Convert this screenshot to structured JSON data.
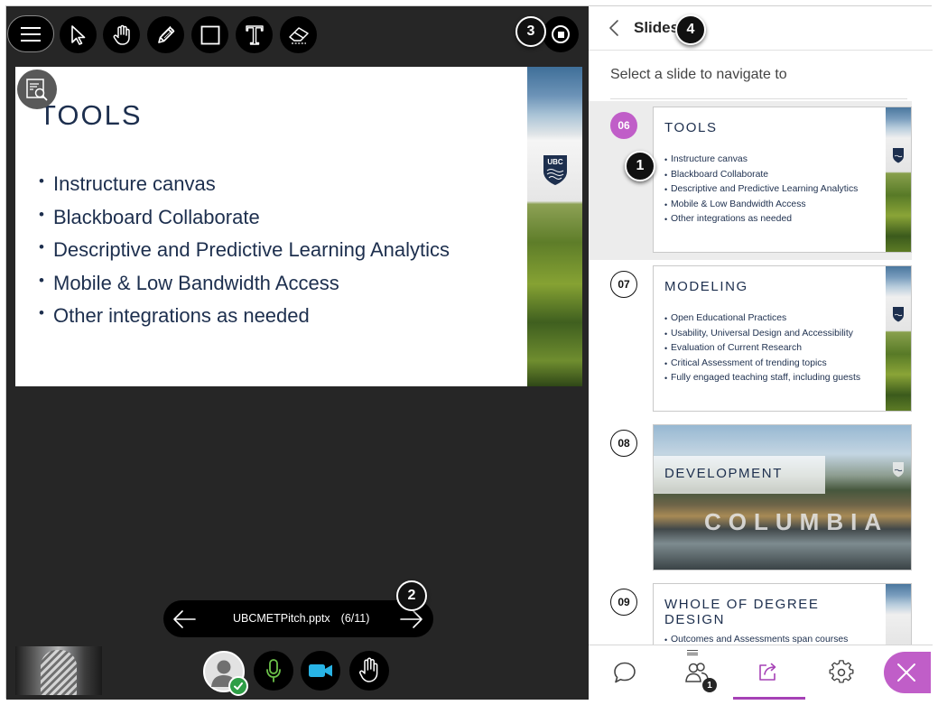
{
  "stage": {
    "current_slide": {
      "title": "TOOLS",
      "bullets": [
        "Instructure canvas",
        "Blackboard Collaborate",
        "Descriptive and Predictive Learning Analytics",
        "Mobile & Low Bandwidth Access",
        "Other integrations as needed"
      ]
    },
    "navigation": {
      "file_name": "UBCMETPitch.pptx",
      "position": "(6/11)"
    },
    "crest_text": "UBC"
  },
  "callouts": [
    "1",
    "2",
    "3",
    "4"
  ],
  "panel": {
    "title": "Slides",
    "subtitle": "Select a slide to navigate to",
    "slides": [
      {
        "number": "06",
        "title": "TOOLS",
        "bullets": [
          "Instructure canvas",
          "Blackboard Collaborate",
          "Descriptive and Predictive Learning Analytics",
          "Mobile & Low Bandwidth Access",
          "Other integrations as needed"
        ]
      },
      {
        "number": "07",
        "title": "MODELING",
        "bullets": [
          "Open Educational Practices",
          "Usability, Universal Design and Accessibility",
          "Evaluation of Current Research",
          "Critical Assessment of trending topics",
          "Fully engaged teaching staff, including guests"
        ]
      },
      {
        "number": "08",
        "title": "DEVELOPMENT",
        "photo_text": "COLUMBIA"
      },
      {
        "number": "09",
        "title": "WHOLE OF DEGREE DESIGN",
        "bullets": [
          "Outcomes and Assessments span courses"
        ]
      }
    ],
    "attendee_count": "1"
  },
  "colors": {
    "accent": "#c05ec8",
    "active_tab": "#a642b6",
    "stage_bg": "#262626",
    "slide_text": "#1d2f4e",
    "status_ok": "#2e9e46",
    "mic": "#6cc24a",
    "camera": "#28b4e6"
  },
  "icons": {
    "toolbar": [
      "menu-icon",
      "select-arrow-icon",
      "pan-hand-icon",
      "pencil-icon",
      "rectangle-icon",
      "text-tool-icon",
      "eraser-icon"
    ],
    "stop": "stop-sharing-icon",
    "bottom": [
      "avatar-icon",
      "microphone-icon",
      "camera-icon",
      "raise-hand-icon"
    ],
    "panel_tabs": [
      "chat-icon",
      "attendees-icon",
      "share-content-icon",
      "settings-icon",
      "close-icon"
    ]
  }
}
